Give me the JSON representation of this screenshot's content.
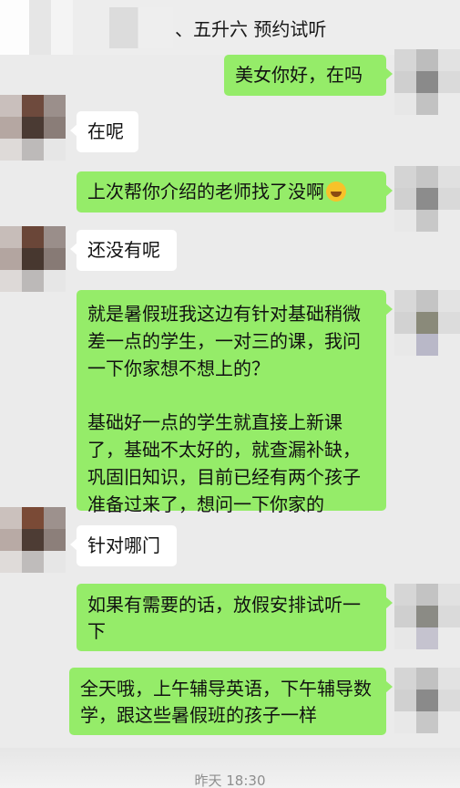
{
  "header": {
    "title": "、五升六  预约试听",
    "back_icon": "back-arrow-icon"
  },
  "messages": [
    {
      "side": "right",
      "text": "美女你好，在吗"
    },
    {
      "side": "left",
      "text": "在呢"
    },
    {
      "side": "right",
      "text": "上次帮你介绍的老师找了没啊",
      "emoji": "laughing-crying-face-icon"
    },
    {
      "side": "left",
      "text": "还没有呢"
    },
    {
      "side": "right",
      "text": "就是暑假班我这边有针对基础稍微差一点的学生，一对三的课，我问一下你家想不想上的？"
    },
    {
      "side": "right",
      "text": "基础好一点的学生就直接上新课了，基础不太好的，就查漏补缺，巩固旧知识，目前已经有两个孩子准备过来了，想问一下你家的"
    },
    {
      "side": "left",
      "text": "针对哪门"
    },
    {
      "side": "right",
      "text": "如果有需要的话，放假安排试听一下"
    },
    {
      "side": "right",
      "text": "全天哦，上午辅导英语，下午辅导数学，跟这些暑假班的孩子一样"
    }
  ],
  "timestamp": "昨天 18:30",
  "colors": {
    "background": "#ebebeb",
    "right_bubble": "#95ec69",
    "left_bubble": "#ffffff"
  }
}
